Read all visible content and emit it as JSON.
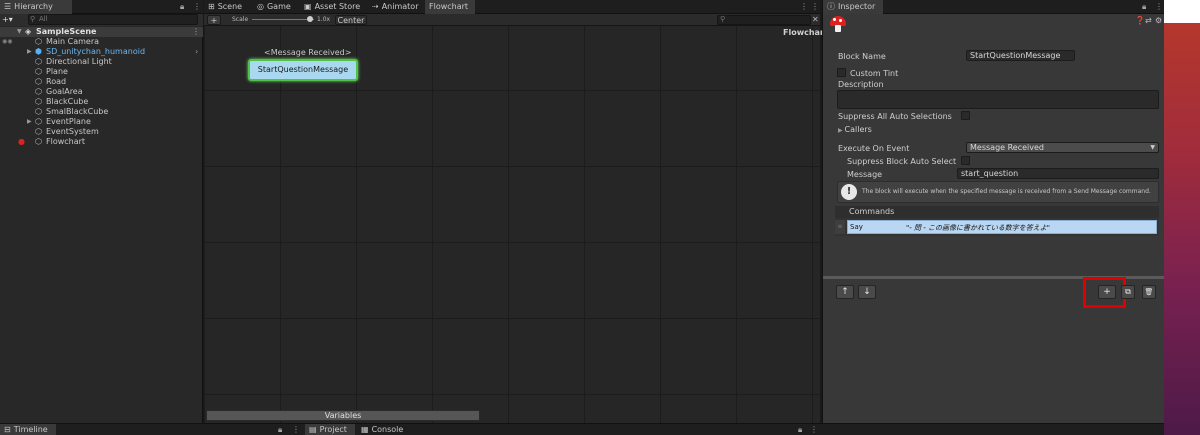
{
  "hierarchy": {
    "tab": "Hierarchy",
    "add": "+▾",
    "search_placeholder": "All",
    "scene": "SampleScene",
    "items": [
      {
        "label": "Main Camera"
      },
      {
        "label": "SD_unitychan_humanoid"
      },
      {
        "label": "Directional Light"
      },
      {
        "label": "Plane"
      },
      {
        "label": "Road"
      },
      {
        "label": "GoalArea"
      },
      {
        "label": "BlackCube"
      },
      {
        "label": "SmalBlackCube"
      },
      {
        "label": "EventPlane"
      },
      {
        "label": "EventSystem"
      },
      {
        "label": "Flowchart"
      }
    ]
  },
  "center": {
    "tabs": [
      {
        "label": "Scene"
      },
      {
        "label": "Game"
      },
      {
        "label": "Asset Store"
      },
      {
        "label": "Animator"
      },
      {
        "label": "Flowchart"
      }
    ],
    "toolbar": {
      "add": "+",
      "scale_label": "Scale",
      "scale_value": "1.0x",
      "center": "Center"
    },
    "canvas_title": "Flowchart",
    "block_event": "<Message Received>",
    "block_name": "StartQuestionMessage",
    "variables": "Variables"
  },
  "inspector": {
    "tab": "Inspector",
    "block_name_label": "Block Name",
    "block_name_value": "StartQuestionMessage",
    "custom_tint": "Custom Tint",
    "description": "Description",
    "suppress_all": "Suppress All Auto Selections",
    "callers": "Callers",
    "execute_on_event": "Execute On Event",
    "execute_value": "Message Received",
    "suppress_block": "Suppress Block Auto Select",
    "message_label": "Message",
    "message_value": "start_question",
    "help": "The block will execute when the specified message is received from a Send Message command.",
    "commands_header": "Commands",
    "command_name": "Say",
    "command_text": "\"- 問 - この画像に書かれている数字を答えよ\"",
    "btn_up": "↑",
    "btn_down": "↓",
    "btn_add": "+",
    "btn_dup": "⧉",
    "btn_del": "🗑"
  },
  "bottom": {
    "timeline": "Timeline",
    "project": "Project",
    "console": "Console"
  },
  "colors": {
    "highlight_box": "#e00000",
    "block_fill": "#a9d8f0",
    "block_border": "#4fc247",
    "command_row": "#b9d6f2"
  }
}
